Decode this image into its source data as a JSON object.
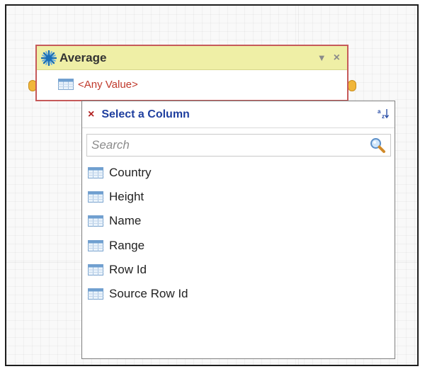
{
  "node": {
    "title": "Average",
    "row_value": "<Any Value>",
    "header_buttons": {
      "menu": "▼",
      "close": "×"
    }
  },
  "popup": {
    "title": "Select a Column",
    "close_glyph": "×",
    "sort_glyph": "a↓",
    "search": {
      "placeholder": "Search",
      "value": ""
    },
    "columns": [
      {
        "label": "Country"
      },
      {
        "label": "Height"
      },
      {
        "label": "Name"
      },
      {
        "label": "Range"
      },
      {
        "label": "Row Id"
      },
      {
        "label": "Source Row Id"
      }
    ]
  },
  "colors": {
    "node_border": "#c65a5a",
    "node_header": "#efefa6",
    "row_text": "#c0392b",
    "popup_title": "#1f3f9f",
    "port": "#f1b63a"
  },
  "icons": {
    "node": "starburst-icon",
    "row": "table-icon",
    "column": "table-icon",
    "search": "magnifier-icon",
    "sort": "sort-alpha-icon"
  }
}
